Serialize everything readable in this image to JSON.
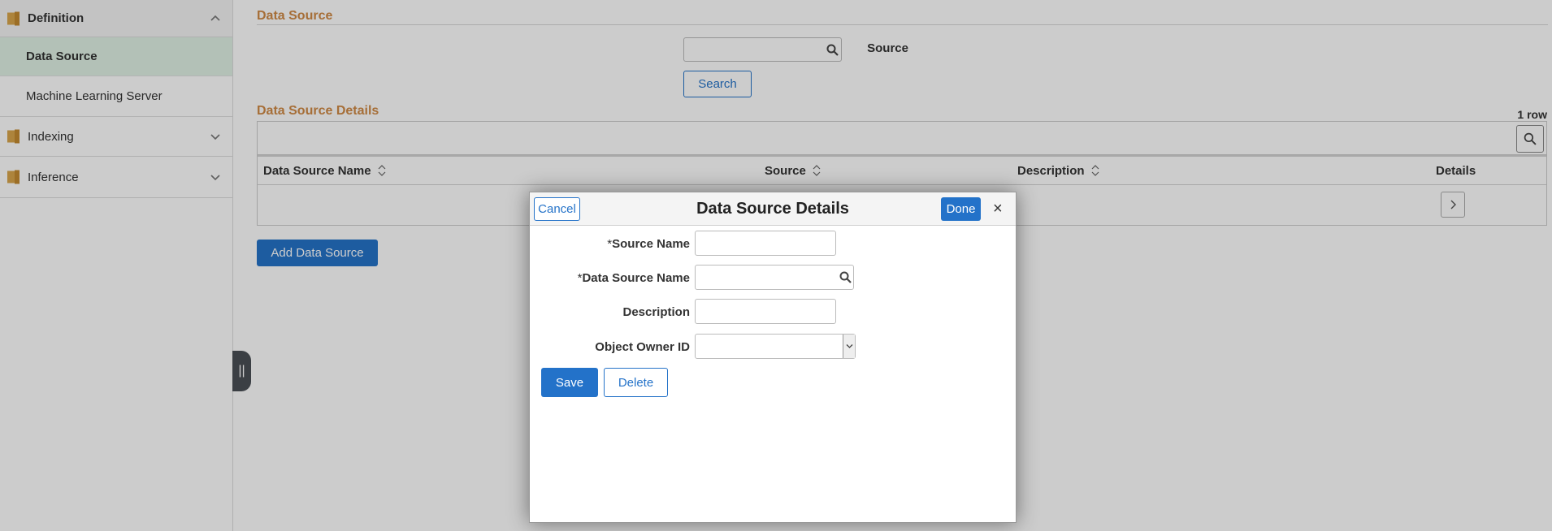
{
  "sidebar": {
    "groups": [
      {
        "label": "Definition",
        "items": [
          {
            "label": "Data Source"
          },
          {
            "label": "Machine Learning Server"
          }
        ]
      },
      {
        "label": "Indexing"
      },
      {
        "label": "Inference"
      }
    ],
    "collapse_glyph": "||"
  },
  "search_section": {
    "title": "Data Source",
    "source_label": "Source",
    "source_value": "",
    "search_button": "Search"
  },
  "details_section": {
    "title": "Data Source Details",
    "row_count": "1 row",
    "columns": [
      "Data Source Name",
      "Source",
      "Description",
      "Details"
    ],
    "add_button": "Add Data Source"
  },
  "modal": {
    "title": "Data Source Details",
    "cancel_label": "Cancel",
    "done_label": "Done",
    "close_glyph": "×",
    "fields": {
      "source_name": {
        "required_mark": "*",
        "label": "Source Name",
        "value": ""
      },
      "data_source_name": {
        "required_mark": "*",
        "label": "Data Source Name",
        "value": ""
      },
      "description": {
        "label": "Description",
        "value": ""
      },
      "object_owner_id": {
        "label": "Object Owner ID",
        "value": ""
      }
    },
    "save_label": "Save",
    "delete_label": "Delete"
  },
  "colors": {
    "accent_blue": "#2372c9",
    "section_title": "#d08a45",
    "active_nav": "#e0f2e5",
    "folder_icon": "#d9a54c"
  },
  "icons": [
    "folder-icon",
    "chevron-up-icon",
    "chevron-down-icon",
    "search-icon",
    "sort-icon",
    "chevron-right-icon",
    "close-icon"
  ]
}
